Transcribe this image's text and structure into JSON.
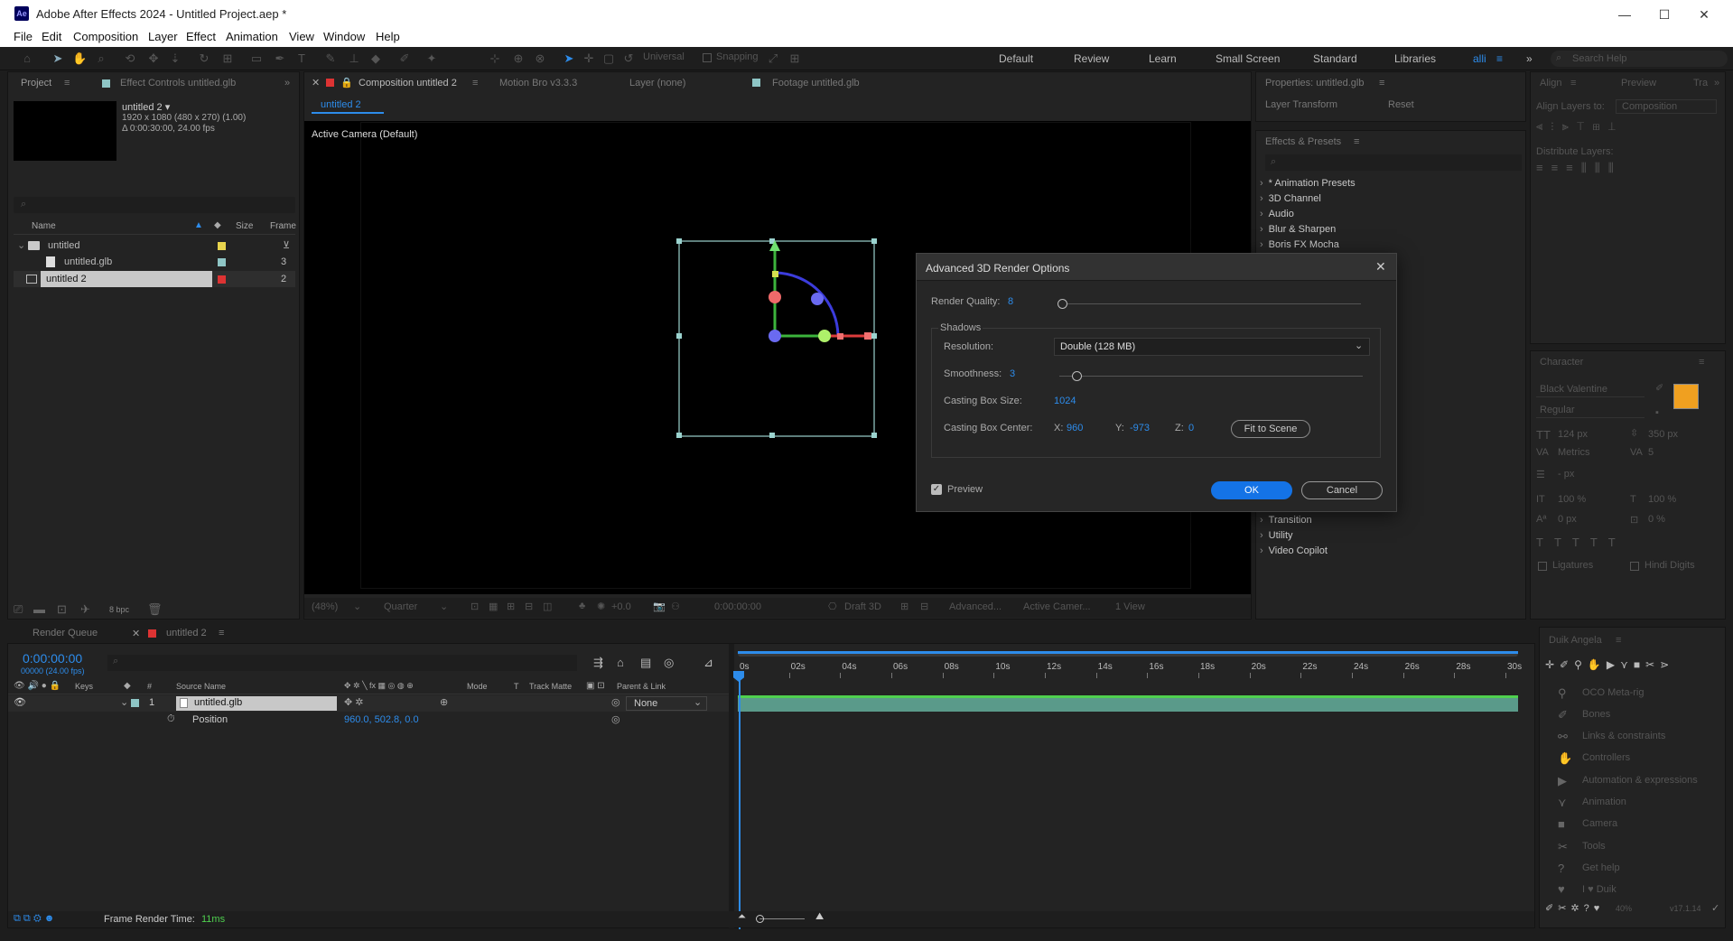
{
  "window": {
    "title": "Adobe After Effects 2024 - Untitled Project.aep *",
    "logo": "Ae"
  },
  "menu": [
    "File",
    "Edit",
    "Composition",
    "Layer",
    "Effect",
    "Animation",
    "View",
    "Window",
    "Help"
  ],
  "toolbar": {
    "universal": "Universal",
    "snapping": "Snapping",
    "workspaces": [
      "Default",
      "Review",
      "Learn",
      "Small Screen",
      "Standard",
      "Libraries",
      "alli"
    ],
    "search_placeholder": "Search Help"
  },
  "project": {
    "tab": "Project",
    "effect_controls_tab": "Effect Controls untitled.glb",
    "selected_name": "untitled 2 ▾",
    "info1": "1920 x 1080  (480 x 270) (1.00)",
    "info2": "Δ 0:00:30:00, 24.00 fps",
    "columns": {
      "name": "Name",
      "size": "Size",
      "frame": "Frame"
    },
    "items": [
      {
        "name": "untitled",
        "type": "folder",
        "value": "",
        "color": "#e8d44d"
      },
      {
        "name": "untitled.glb",
        "type": "file",
        "value": "3",
        "color": "#8ec5c5"
      },
      {
        "name": "untitled 2",
        "type": "comp",
        "value": "2",
        "color": "#d33"
      }
    ],
    "bpc": "8 bpc"
  },
  "comp": {
    "tabs": [
      "Composition untitled 2",
      "Motion Bro v3.3.3",
      "Layer (none)",
      "Footage untitled.glb"
    ],
    "subtab": "untitled 2",
    "camera_label": "Active Camera (Default)",
    "bottom": {
      "zoom": "(48%)",
      "res": "Quarter",
      "exposure": "+0.0",
      "time": "0:00:00:00",
      "renderer": "Draft 3D",
      "advanced": "Advanced...",
      "camera": "Active Camer...",
      "view": "1 View"
    }
  },
  "properties": {
    "title": "Properties: untitled.glb",
    "layer_transform": "Layer Transform",
    "reset": "Reset"
  },
  "effects": {
    "title": "Effects & Presets",
    "items_top": [
      "* Animation Presets",
      "3D Channel",
      "Audio",
      "Blur & Sharpen",
      "Boris FX Mocha"
    ],
    "items_bottom": [
      "Transition",
      "Utility",
      "Video Copilot"
    ]
  },
  "align": {
    "tabs": [
      "Align",
      "Preview",
      "Tra"
    ],
    "align_to_label": "Align Layers to:",
    "align_to_value": "Composition",
    "distribute": "Distribute Layers:"
  },
  "character": {
    "title": "Character",
    "font": "Black Valentine",
    "style": "Regular",
    "size": "124 px",
    "leading": "350 px",
    "kerning": "Metrics",
    "tracking": "5",
    "stroke": "- px",
    "vscale": "100 %",
    "hscale": "100 %",
    "baseline": "0 px",
    "tsume": "0 %",
    "ligatures": "Ligatures",
    "hindi": "Hindi Digits",
    "fill_color": "#f0a020"
  },
  "dialog": {
    "title": "Advanced 3D Render Options",
    "render_quality_label": "Render Quality:",
    "render_quality": "8",
    "render_quality_frac": 0.0,
    "shadows_label": "Shadows",
    "resolution_label": "Resolution:",
    "resolution": "Double (128 MB)",
    "smoothness_label": "Smoothness:",
    "smoothness": "3",
    "smoothness_frac": 0.06,
    "casting_size_label": "Casting Box Size:",
    "casting_size": "1024",
    "casting_center_label": "Casting Box Center:",
    "x_label": "X:",
    "x": "960",
    "y_label": "Y:",
    "y": "-973",
    "z_label": "Z:",
    "z": "0",
    "fit_btn": "Fit to Scene",
    "preview_label": "Preview",
    "ok": "OK",
    "cancel": "Cancel"
  },
  "render_queue": {
    "tab1": "Render Queue",
    "tab2": "untitled 2"
  },
  "timeline": {
    "timecode": "0:00:00:00",
    "frames": "00000 (24.00 fps)",
    "columns": {
      "keys": "Keys",
      "num": "#",
      "source": "Source Name",
      "mode": "Mode",
      "t": "T",
      "matte": "Track Matte",
      "parent": "Parent & Link"
    },
    "layer": {
      "num": "1",
      "name": "untitled.glb",
      "parent": "None"
    },
    "position_label": "Position",
    "position_value": "960.0, 502.8, 0.0",
    "ruler": [
      "0s",
      "02s",
      "04s",
      "06s",
      "08s",
      "10s",
      "12s",
      "14s",
      "16s",
      "18s",
      "20s",
      "22s",
      "24s",
      "26s",
      "28s",
      "30s"
    ],
    "frame_render_label": "Frame Render Time:",
    "frame_render_value": "11ms"
  },
  "duik": {
    "title": "Duik Angela",
    "items": [
      "OCO Meta-rig",
      "Bones",
      "Links & constraints",
      "Controllers",
      "Automation & expressions",
      "Animation",
      "Camera",
      "Tools",
      "Get help",
      "I ♥ Duik"
    ],
    "version": "v17.1.14",
    "percent": "40%"
  }
}
